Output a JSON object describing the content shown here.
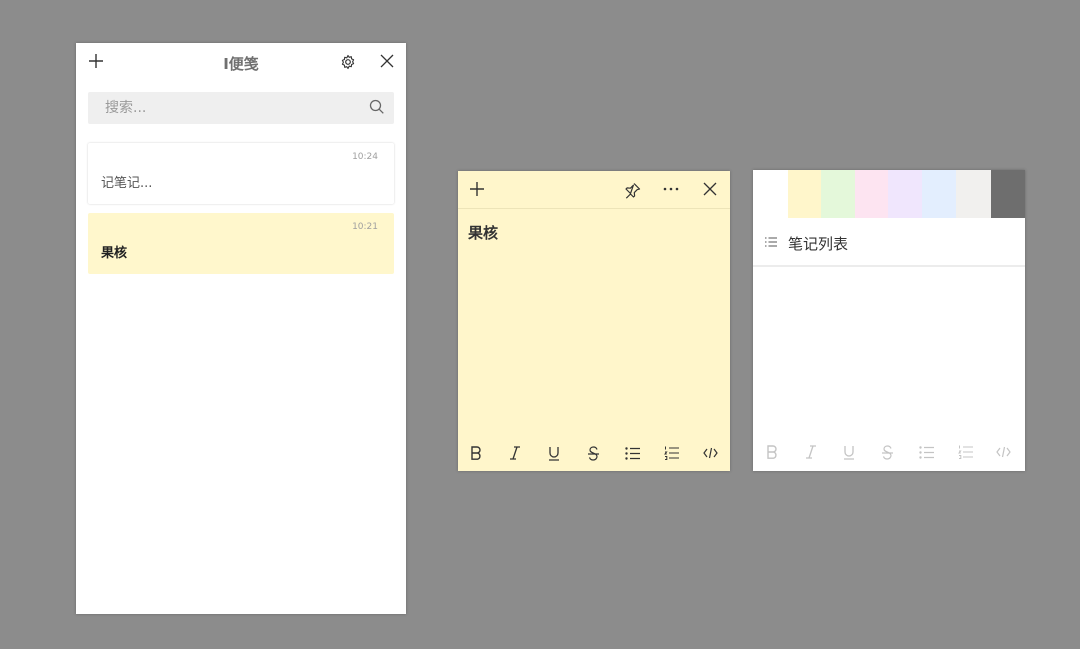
{
  "list_window": {
    "title": "I便笺",
    "search": {
      "placeholder": "搜索...",
      "value": ""
    },
    "notes": [
      {
        "time": "10:24",
        "text": "记笔记...",
        "color": "#ffffff"
      },
      {
        "time": "10:21",
        "text": "果核",
        "color": "#fff7cc"
      }
    ],
    "icons": [
      "plus-icon",
      "gear-icon",
      "close-icon",
      "search-icon"
    ]
  },
  "note_editor": {
    "background": "#fff6cb",
    "content": "果核",
    "icons": [
      "plus-icon",
      "pin-icon",
      "more-icon",
      "close-icon"
    ],
    "format": [
      "bold",
      "italic",
      "underline",
      "strikethrough",
      "bullet-list",
      "numbered-list",
      "code"
    ]
  },
  "note_menu": {
    "color_swatches": [
      "#ffffff",
      "#fff6cb",
      "#e4f8da",
      "#fde4f1",
      "#f0e6fd",
      "#e3eefe",
      "#f1f0ee",
      "#6e6e6e"
    ],
    "menu_item_label": "笔记列表",
    "format": [
      "bold",
      "italic",
      "underline",
      "strikethrough",
      "bullet-list",
      "numbered-list",
      "code"
    ]
  }
}
